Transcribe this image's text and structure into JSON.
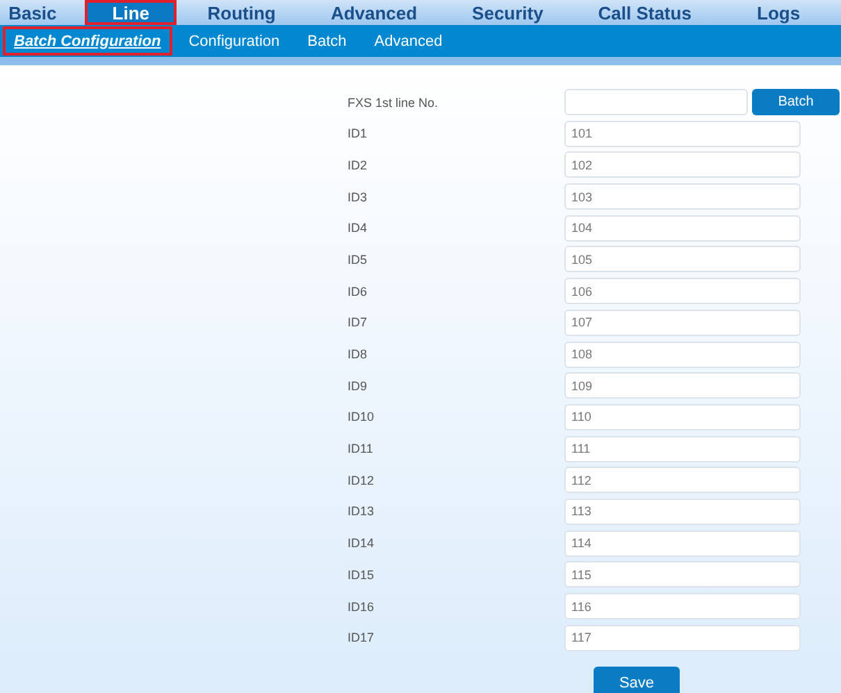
{
  "main_tabs": [
    {
      "label": "Basic",
      "selected": false
    },
    {
      "label": "Line",
      "selected": true
    },
    {
      "label": "Routing",
      "selected": false
    },
    {
      "label": "Advanced",
      "selected": false
    },
    {
      "label": "Security",
      "selected": false
    },
    {
      "label": "Call Status",
      "selected": false
    },
    {
      "label": "Logs",
      "selected": false
    }
  ],
  "sub_tabs": [
    {
      "label": "Batch Configuration",
      "selected": true
    },
    {
      "label": "Configuration",
      "selected": false
    },
    {
      "label": "Batch",
      "selected": false
    },
    {
      "label": "Advanced",
      "selected": false
    }
  ],
  "form": {
    "first_line": {
      "label": "FXS 1st line No.",
      "button": "Batch"
    },
    "rows": [
      {
        "label": "ID1",
        "value": "101"
      },
      {
        "label": "ID2",
        "value": "102"
      },
      {
        "label": "ID3",
        "value": "103"
      },
      {
        "label": "ID4",
        "value": "104"
      },
      {
        "label": "ID5",
        "value": "105"
      },
      {
        "label": "ID6",
        "value": "106"
      },
      {
        "label": "ID7",
        "value": "107"
      },
      {
        "label": "ID8",
        "value": "108"
      },
      {
        "label": "ID9",
        "value": "109"
      },
      {
        "label": "ID10",
        "value": "110"
      },
      {
        "label": "ID11",
        "value": "111"
      },
      {
        "label": "ID12",
        "value": "112"
      },
      {
        "label": "ID13",
        "value": "113"
      },
      {
        "label": "ID14",
        "value": "114"
      },
      {
        "label": "ID15",
        "value": "115"
      },
      {
        "label": "ID16",
        "value": "116"
      },
      {
        "label": "ID17",
        "value": "117"
      }
    ],
    "save_button": "Save"
  }
}
